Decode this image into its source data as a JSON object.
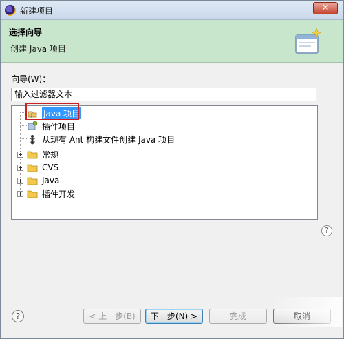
{
  "window": {
    "title": "新建项目"
  },
  "banner": {
    "title": "选择向导",
    "subtitle": "创建 Java 项目"
  },
  "wizard": {
    "label": "向导(W)：",
    "filter_placeholder": "输入过滤器文本"
  },
  "tree": {
    "items": [
      {
        "label": "Java 项目",
        "icon": "java-project-icon",
        "selected": true
      },
      {
        "label": "插件项目",
        "icon": "plugin-project-icon"
      },
      {
        "label": "从现有 Ant 构建文件创建 Java 项目",
        "icon": "ant-icon"
      },
      {
        "label": "常规",
        "icon": "folder-icon",
        "expandable": true
      },
      {
        "label": "CVS",
        "icon": "folder-icon",
        "expandable": true
      },
      {
        "label": "Java",
        "icon": "folder-icon",
        "expandable": true
      },
      {
        "label": "插件开发",
        "icon": "folder-icon",
        "expandable": true
      }
    ]
  },
  "buttons": {
    "back": "< 上一步(B)",
    "next": "下一步(N) >",
    "finish": "完成",
    "cancel": "取消"
  },
  "help_glyph": "?",
  "close_glyph": "✕",
  "colors": {
    "banner": "#c8e6cc",
    "selection": "#3399ff",
    "highlight": "#cc1f1f"
  }
}
